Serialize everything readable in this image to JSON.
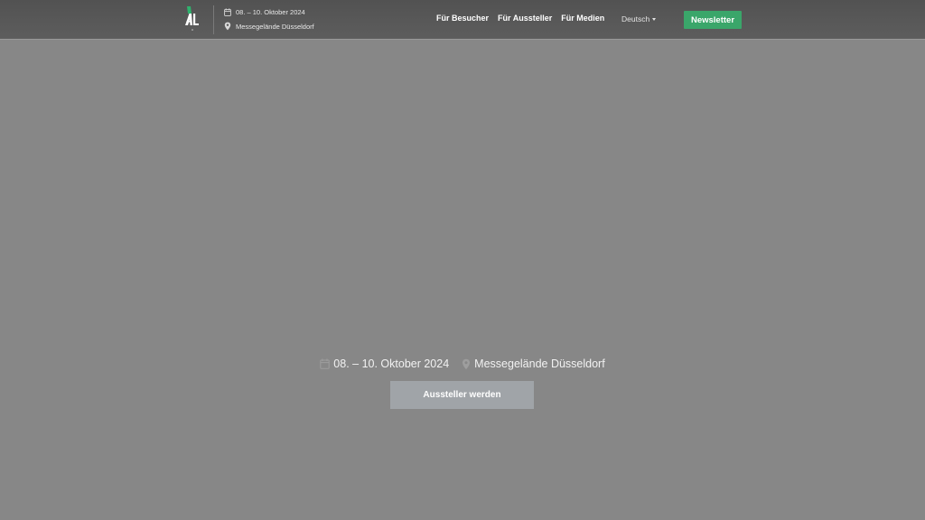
{
  "header": {
    "logo": {
      "text": "AL",
      "accent_color": "#2fb36e"
    },
    "event_date": "08. – 10. Oktober 2024",
    "event_location": "Messegelände Düsseldorf",
    "nav": [
      {
        "label": "Für Besucher"
      },
      {
        "label": "Für Aussteller"
      },
      {
        "label": "Für Medien"
      }
    ],
    "language": "Deutsch",
    "newsletter_label": "Newsletter"
  },
  "hero": {
    "date": "08. – 10. Oktober 2024",
    "location": "Messegelände Düsseldorf",
    "cta_label": "Aussteller werden"
  },
  "colors": {
    "accent_green": "#3aa66a",
    "header_bg": "#555555",
    "page_bg": "#878787",
    "cta_bg": "#a0a4a8"
  },
  "icons": {
    "date": "calendar-icon",
    "location": "map-pin-icon",
    "language": "caret-down-icon"
  }
}
